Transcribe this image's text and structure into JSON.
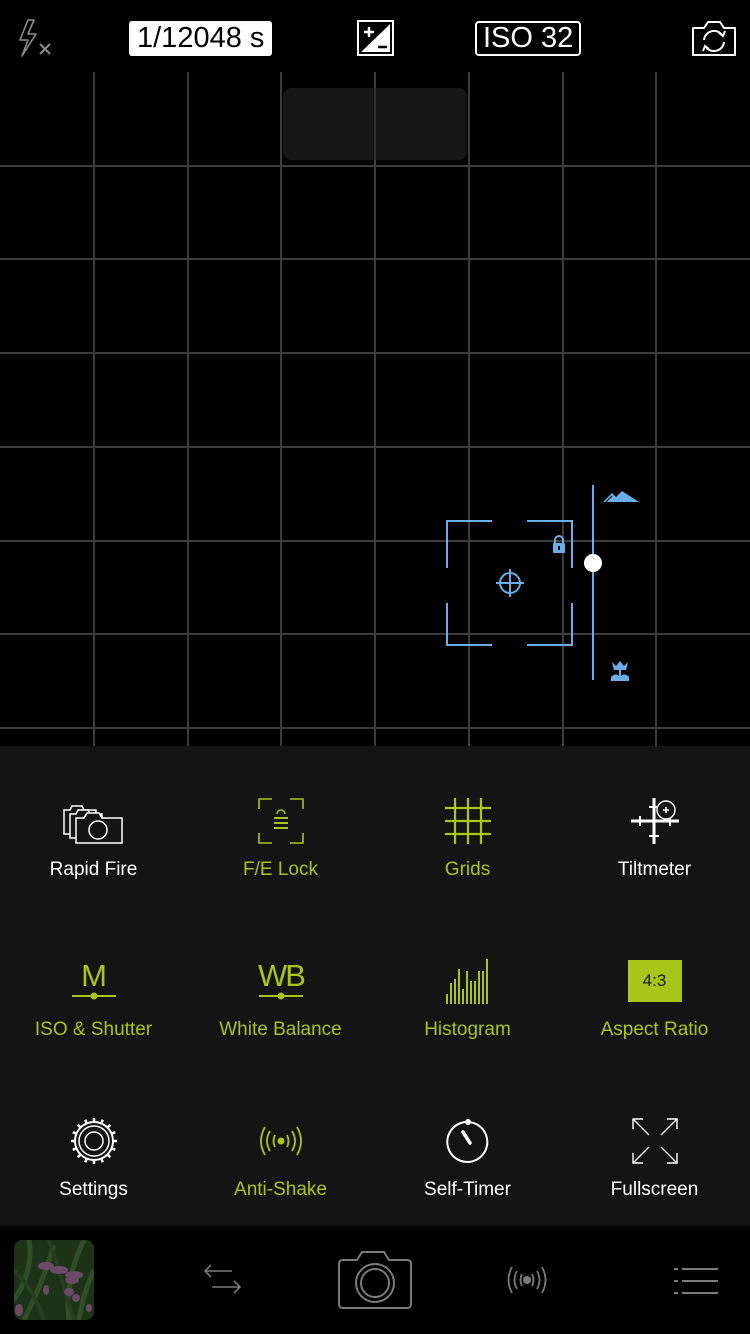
{
  "top_bar": {
    "flash_icon": "flash-off-icon",
    "shutter_speed": "1/12048 s",
    "exposure_icon": "exposure-compensation-icon",
    "iso": "ISO 32",
    "flip_camera_icon": "flip-camera-icon"
  },
  "viewfinder": {
    "grid": {
      "columns": 8,
      "rows": 8
    },
    "focus_overlay": {
      "crosshair_icon": "crosshair-icon",
      "lock_icon": "lock-icon",
      "slider_top_icon": "mountain-icon",
      "slider_bottom_icon": "macro-flower-icon",
      "focus_slider_value": 0.6
    }
  },
  "panel": {
    "tiles": [
      {
        "label": "Rapid Fire",
        "icon": "rapid-fire-icon",
        "active": false
      },
      {
        "label": "F/E Lock",
        "icon": "fe-lock-icon",
        "active": true
      },
      {
        "label": "Grids",
        "icon": "grid-icon",
        "active": true
      },
      {
        "label": "Tiltmeter",
        "icon": "tiltmeter-icon",
        "active": false
      },
      {
        "label": "ISO & Shutter",
        "icon": "manual-mode-icon",
        "icon_text": "M",
        "active": true
      },
      {
        "label": "White Balance",
        "icon": "white-balance-icon",
        "icon_text": "WB",
        "active": true
      },
      {
        "label": "Histogram",
        "icon": "histogram-icon",
        "active": true
      },
      {
        "label": "Aspect Ratio",
        "icon": "aspect-ratio-icon",
        "icon_text": "4:3",
        "active": true
      },
      {
        "label": "Settings",
        "icon": "settings-gear-icon",
        "active": false
      },
      {
        "label": "Anti-Shake",
        "icon": "anti-shake-icon",
        "active": true
      },
      {
        "label": "Self-Timer",
        "icon": "self-timer-icon",
        "active": false
      },
      {
        "label": "Fullscreen",
        "icon": "fullscreen-icon",
        "active": false
      }
    ]
  },
  "bottom_bar": {
    "thumbnail": "last-photo-thumbnail",
    "switch_icon": "swap-arrows-icon",
    "shutter_icon": "camera-shutter-icon",
    "stabilizer_icon": "anti-shake-icon",
    "menu_icon": "menu-list-icon"
  },
  "colors": {
    "accent": "#a8c51a",
    "focus_blue": "#6aaee8",
    "panel_bg": "#141414",
    "grid_line": "#3c3c3c"
  }
}
